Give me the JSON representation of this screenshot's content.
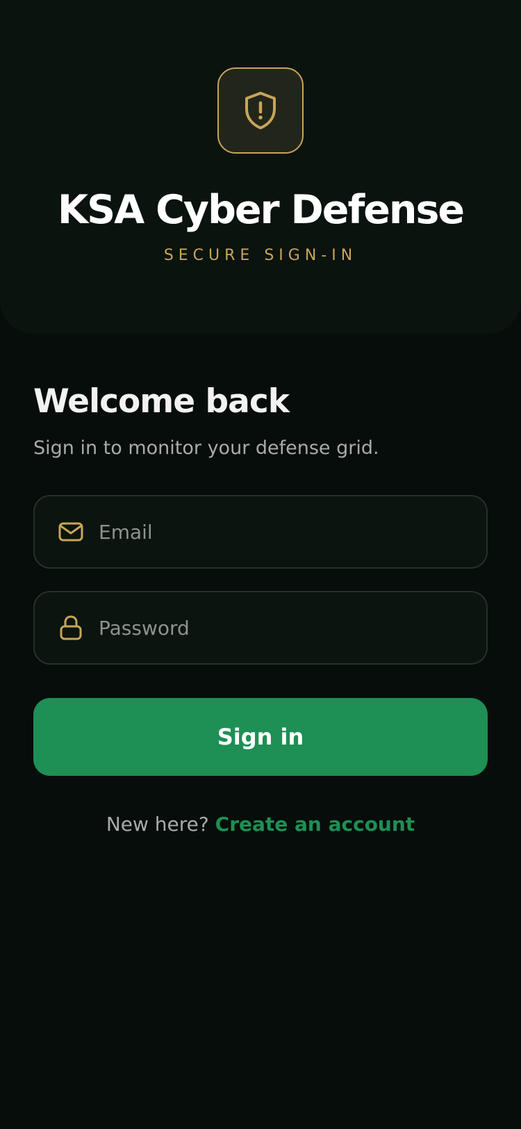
{
  "header": {
    "app_title": "KSA Cyber Defense",
    "app_subtitle": "SECURE SIGN-IN",
    "logo_icon": "shield-alert-icon"
  },
  "form": {
    "heading": "Welcome back",
    "subheading": "Sign in to monitor your defense grid.",
    "email": {
      "icon": "mail-icon",
      "placeholder": "Email",
      "value": ""
    },
    "password": {
      "icon": "lock-icon",
      "placeholder": "Password",
      "value": ""
    },
    "submit_label": "Sign in"
  },
  "footer": {
    "prompt": "New here?",
    "link_label": "Create an account"
  },
  "colors": {
    "background": "#070d0a",
    "hero_background": "#0b130f",
    "accent_gold": "#c9a55a",
    "primary_green": "#1e8f55"
  }
}
